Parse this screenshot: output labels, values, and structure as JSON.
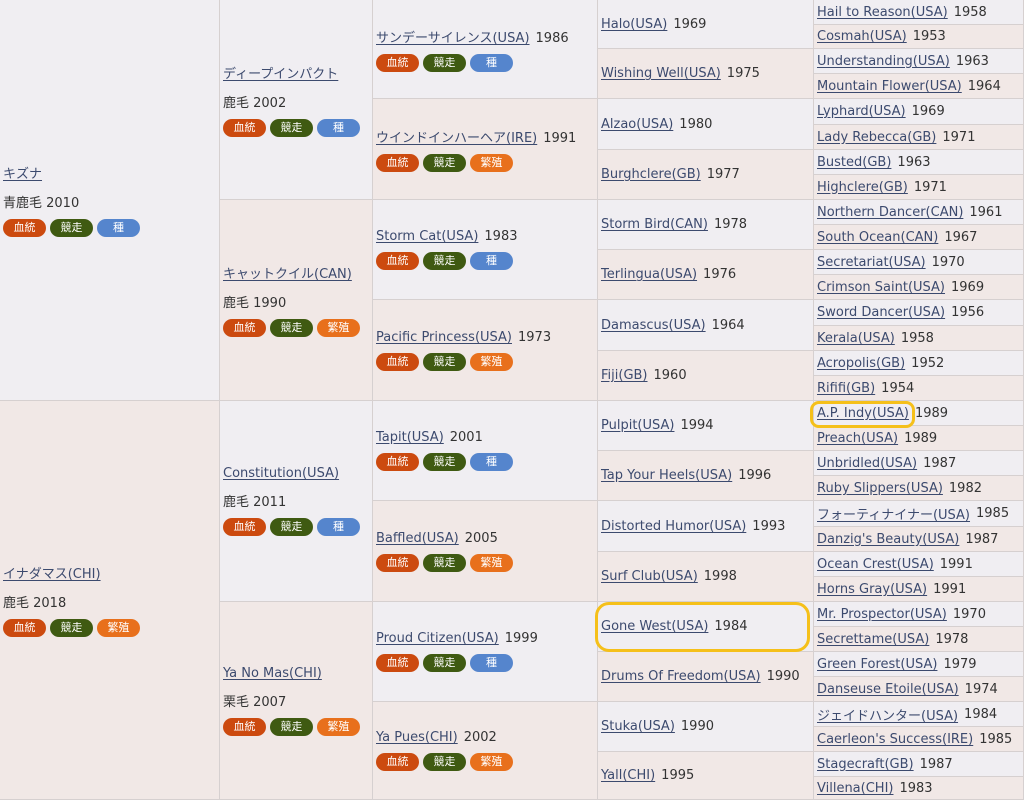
{
  "badge_labels": {
    "blood": "血統",
    "race": "競走",
    "sire": "種",
    "breed": "繁殖"
  },
  "colors": {
    "blood": "#cc4a0f",
    "race": "#3f5a12",
    "sire": "#5585cd",
    "breed": "#e8701c",
    "highlight": "#f5c01a"
  },
  "gen1": [
    {
      "name": "キズナ",
      "info": "青鹿毛 2010",
      "role": "sire"
    },
    {
      "name": "イナダマス(CHI)",
      "info": "鹿毛 2018",
      "role": "breed"
    }
  ],
  "gen2": [
    {
      "name": "ディープインパクト",
      "info": "鹿毛 2002",
      "role": "sire"
    },
    {
      "name": "キャットクイル(CAN)",
      "info": "鹿毛 1990",
      "role": "breed"
    },
    {
      "name": "Constitution(USA)",
      "info": "鹿毛 2011",
      "role": "sire"
    },
    {
      "name": "Ya No Mas(CHI)",
      "info": "栗毛 2007",
      "role": "breed"
    }
  ],
  "gen3": [
    {
      "name": "サンデーサイレンス(USA)",
      "year": "1986",
      "role": "sire"
    },
    {
      "name": "ウインドインハーヘア(IRE)",
      "year": "1991",
      "role": "breed"
    },
    {
      "name": "Storm Cat(USA)",
      "year": "1983",
      "role": "sire"
    },
    {
      "name": "Pacific Princess(USA)",
      "year": "1973",
      "role": "breed"
    },
    {
      "name": "Tapit(USA)",
      "year": "2001",
      "role": "sire"
    },
    {
      "name": "Baffled(USA)",
      "year": "2005",
      "role": "breed"
    },
    {
      "name": "Proud Citizen(USA)",
      "year": "1999",
      "role": "sire"
    },
    {
      "name": "Ya Pues(CHI)",
      "year": "2002",
      "role": "breed"
    }
  ],
  "gen4": [
    {
      "name": "Halo(USA)",
      "year": "1969"
    },
    {
      "name": "Wishing Well(USA)",
      "year": "1975"
    },
    {
      "name": "Alzao(USA)",
      "year": "1980"
    },
    {
      "name": "Burghclere(GB)",
      "year": "1977"
    },
    {
      "name": "Storm Bird(CAN)",
      "year": "1978"
    },
    {
      "name": "Terlingua(USA)",
      "year": "1976"
    },
    {
      "name": "Damascus(USA)",
      "year": "1964"
    },
    {
      "name": "Fiji(GB)",
      "year": "1960"
    },
    {
      "name": "Pulpit(USA)",
      "year": "1994"
    },
    {
      "name": "Tap Your Heels(USA)",
      "year": "1996"
    },
    {
      "name": "Distorted Humor(USA)",
      "year": "1993"
    },
    {
      "name": "Surf Club(USA)",
      "year": "1998"
    },
    {
      "name": "Gone West(USA)",
      "year": "1984"
    },
    {
      "name": "Drums Of Freedom(USA)",
      "year": "1990"
    },
    {
      "name": "Stuka(USA)",
      "year": "1990"
    },
    {
      "name": "Yall(CHI)",
      "year": "1995"
    }
  ],
  "gen5": [
    {
      "name": "Hail to Reason(USA)",
      "year": "1958"
    },
    {
      "name": "Cosmah(USA)",
      "year": "1953"
    },
    {
      "name": "Understanding(USA)",
      "year": "1963"
    },
    {
      "name": "Mountain Flower(USA)",
      "year": "1964"
    },
    {
      "name": "Lyphard(USA)",
      "year": "1969"
    },
    {
      "name": "Lady Rebecca(GB)",
      "year": "1971"
    },
    {
      "name": "Busted(GB)",
      "year": "1963"
    },
    {
      "name": "Highclere(GB)",
      "year": "1971"
    },
    {
      "name": "Northern Dancer(CAN)",
      "year": "1961"
    },
    {
      "name": "South Ocean(CAN)",
      "year": "1967"
    },
    {
      "name": "Secretariat(USA)",
      "year": "1970"
    },
    {
      "name": "Crimson Saint(USA)",
      "year": "1969"
    },
    {
      "name": "Sword Dancer(USA)",
      "year": "1956"
    },
    {
      "name": "Kerala(USA)",
      "year": "1958"
    },
    {
      "name": "Acropolis(GB)",
      "year": "1952"
    },
    {
      "name": "Rififi(GB)",
      "year": "1954"
    },
    {
      "name": "A.P. Indy(USA)",
      "year": "1989"
    },
    {
      "name": "Preach(USA)",
      "year": "1989"
    },
    {
      "name": "Unbridled(USA)",
      "year": "1987"
    },
    {
      "name": "Ruby Slippers(USA)",
      "year": "1982"
    },
    {
      "name": "フォーティナイナー(USA)",
      "year": "1985"
    },
    {
      "name": "Danzig's Beauty(USA)",
      "year": "1987"
    },
    {
      "name": "Ocean Crest(USA)",
      "year": "1991"
    },
    {
      "name": "Horns Gray(USA)",
      "year": "1991"
    },
    {
      "name": "Mr. Prospector(USA)",
      "year": "1970"
    },
    {
      "name": "Secrettame(USA)",
      "year": "1978"
    },
    {
      "name": "Green Forest(USA)",
      "year": "1979"
    },
    {
      "name": "Danseuse Etoile(USA)",
      "year": "1974"
    },
    {
      "name": "ジェイドハンター(USA)",
      "year": "1984"
    },
    {
      "name": "Caerleon's Success(IRE)",
      "year": "1985"
    },
    {
      "name": "Stagecraft(GB)",
      "year": "1987"
    },
    {
      "name": "Villena(CHI)",
      "year": "1983"
    }
  ]
}
